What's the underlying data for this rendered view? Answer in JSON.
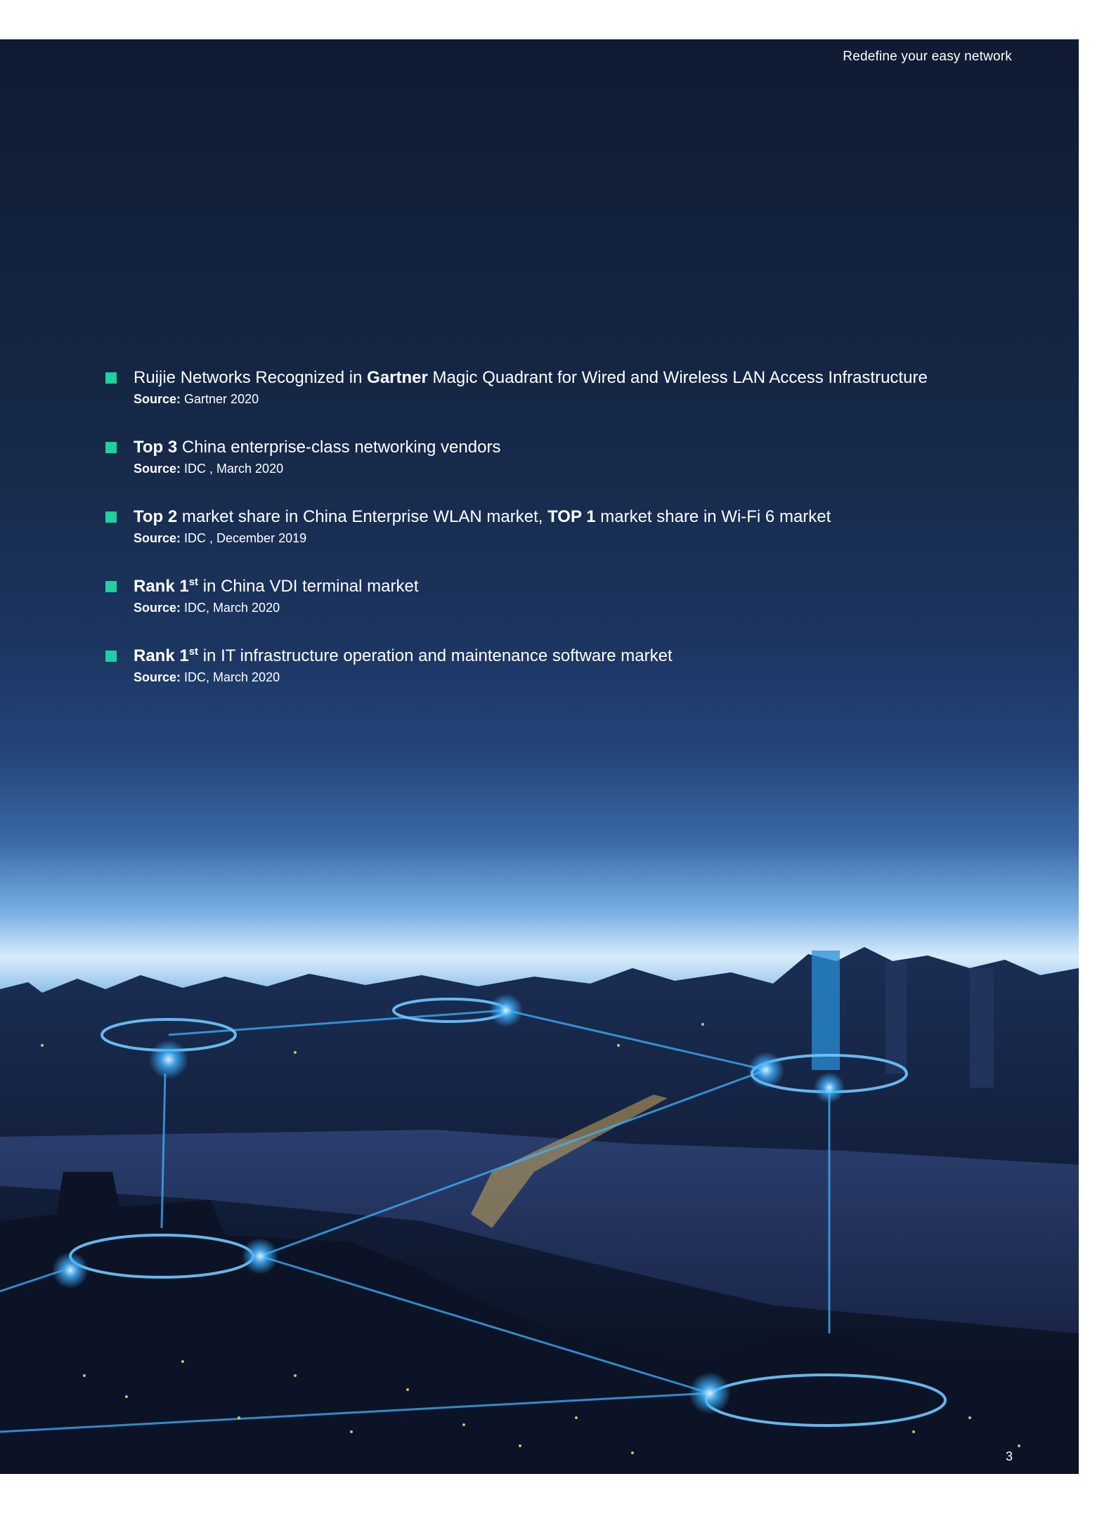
{
  "header": {
    "tagline": "Redefine  your easy network"
  },
  "achievements": [
    {
      "pre": "Ruijie Networks Recognized in ",
      "bold1": "Gartner",
      "post": " Magic Quadrant for Wired and Wireless LAN Access Infrastructure",
      "source_label": "Source:",
      "source_text": " Gartner 2020"
    },
    {
      "bold1": "Top 3",
      "post": " China enterprise-class networking vendors",
      "source_label": "Source:",
      "source_text": "  IDC , March 2020"
    },
    {
      "bold1": "Top 2",
      "mid": " market share in China Enterprise WLAN market, ",
      "bold2": "TOP 1",
      "post": " market share in Wi-Fi 6 market",
      "source_label": "Source:",
      "source_text": " IDC , December 2019"
    },
    {
      "bold1": "Rank 1",
      "sup": "st",
      "post": " in China VDI  terminal market",
      "source_label": "Source:",
      "source_text": " IDC, March 2020"
    },
    {
      "bold1": "Rank 1",
      "sup": "st",
      "post": " in IT infrastructure operation and maintenance software market",
      "source_label": "Source:",
      "source_text": " IDC, March 2020"
    }
  ],
  "footer": {
    "page_number": "3"
  },
  "colors": {
    "bullet": "#1ed1a0",
    "network_glow": "#3fb2ff"
  }
}
